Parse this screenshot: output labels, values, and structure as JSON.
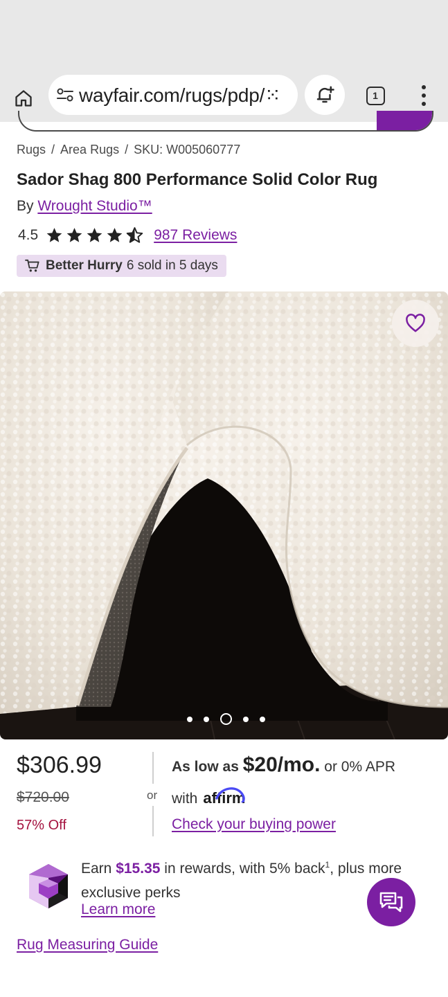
{
  "browser": {
    "url": "wayfair.com/rugs/pdp/⁙",
    "tab_count": "1"
  },
  "breadcrumb": {
    "items": [
      "Rugs",
      "Area Rugs",
      "SKU: W005060777"
    ],
    "separator": "/"
  },
  "product": {
    "title": "Sador Shag 800 Performance Solid Color Rug",
    "by_prefix": "By",
    "brand": "Wrought Studio™",
    "rating": "4.5",
    "rating_value": 4.5,
    "rating_max": 5,
    "reviews_link": "987 Reviews",
    "urgency": {
      "icon": "cart-icon",
      "label": "Better Hurry",
      "detail": "6 sold in 5 days"
    },
    "image": {
      "slide_count": 5,
      "active_slide": 3
    }
  },
  "price": {
    "current": "$306.99",
    "original": "$720.00",
    "discount": "57% Off",
    "or_label": "or",
    "financing_prefix": "As low as",
    "financing_amount": "$20/mo.",
    "financing_suffix": "or 0% APR",
    "with_label": "with",
    "affirm_brand": "affirm",
    "check_link": "Check your buying power"
  },
  "rewards": {
    "earn_prefix": "Earn",
    "amount": "$15.35",
    "earn_middle": "in rewards, with 5% back",
    "footnote": "1",
    "earn_suffix": ", plus more exclusive perks",
    "learn_more": "Learn more"
  },
  "guide_link": "Rug Measuring Guide",
  "colors": {
    "brand_purple": "#7b1fa2",
    "discount_red": "#a4123f",
    "badge_bg": "#eadcf0"
  }
}
